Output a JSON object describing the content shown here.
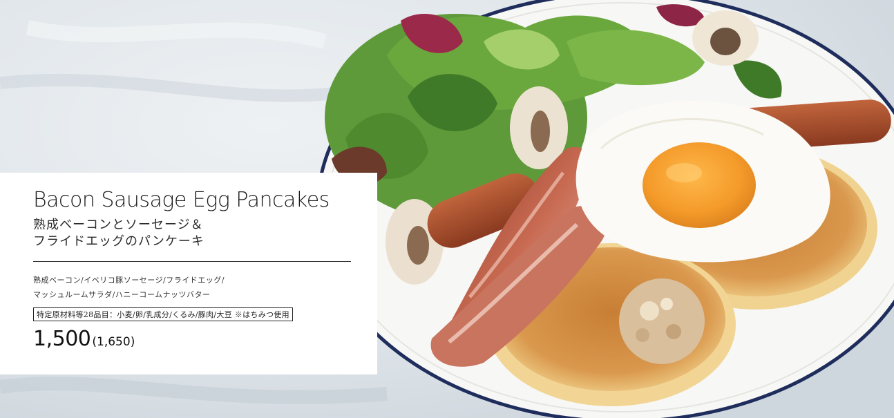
{
  "menu": {
    "title_en": "Bacon Sausage Egg Pancakes",
    "title_ja_line1": "熟成ベーコンとソーセージ＆",
    "title_ja_line2": "フライドエッグのパンケーキ",
    "ingredients_line1": "熟成ベーコン/イベリコ豚ソーセージ/フライドエッグ/",
    "ingredients_line2": "マッシュルームサラダ/ハニーコームナッツバター",
    "allergen_note": "特定原材料等28品目：小麦/卵/乳成分/くるみ/豚肉/大豆 ※はちみつ使用",
    "price": "1,500",
    "price_with_tax": "(1,650)"
  },
  "photo": {
    "subject": "bacon-sausage-egg-pancake-plate",
    "colors": {
      "background": "#e6eaee",
      "plate": "#f7f7f5",
      "plate_rim": "#1f2d5c",
      "pancake": "#e0a85a",
      "yolk": "#f2a23a",
      "bacon": "#b5583f",
      "sausage": "#a24a2c",
      "lettuce": "#4d8a32"
    }
  }
}
